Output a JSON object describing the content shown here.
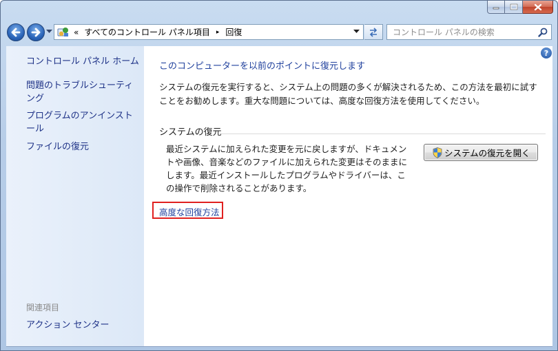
{
  "window": {
    "caption": {
      "minimize_icon": "minimize-icon",
      "maximize_icon": "maximize-icon",
      "close_icon": "close-icon"
    }
  },
  "navbar": {
    "address": {
      "chevron": "«",
      "crumb_1": "すべてのコントロール パネル項目",
      "separator": "▸",
      "crumb_2": "回復"
    },
    "search": {
      "placeholder": "コントロール パネルの検索"
    }
  },
  "sidebar": {
    "home": "コントロール パネル ホーム",
    "troubleshoot": "問題のトラブルシューティング",
    "uninstall": "プログラムのアンインストール",
    "file_recovery": "ファイルの復元",
    "related_heading": "関連項目",
    "action_center": "アクション センター"
  },
  "main": {
    "help": "?",
    "heading": "このコンピューターを以前のポイントに復元します",
    "description": "システムの復元を実行すると、システム上の問題の多くが解決されるため、この方法を最初に試すことをお勧めします。重大な問題については、高度な回復方法を使用してください。",
    "section_title": "システムの復元",
    "section_body": "最近システムに加えられた変更を元に戻しますが、ドキュメントや画像、音楽などのファイルに加えられた変更はそのままにします。最近インストールしたプログラムやドライバーは、この操作で削除されることがあります。",
    "open_restore_button": "システムの復元を開く",
    "advanced_link": "高度な回復方法"
  },
  "colors": {
    "link": "#1e3f9c",
    "sidebar_link": "#1e3287",
    "highlight_box": "#e0201f",
    "frame": "#b7cde8"
  }
}
